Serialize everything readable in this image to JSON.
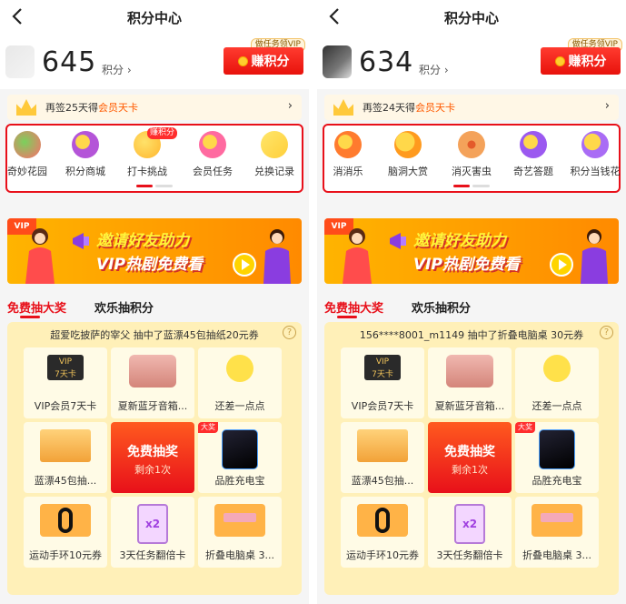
{
  "panels": [
    {
      "title": "积分中心",
      "points": "645",
      "points_unit": "积分 ›",
      "earn_label": "赚积分",
      "vip_tag": "做任务领VIP",
      "signin_prefix": "再签25天得",
      "signin_highlight": "会员天卡",
      "signin_arrow": "›",
      "icons": [
        {
          "label": "奇妙花园",
          "icon": "garden-icon",
          "color": "#ff6b6b"
        },
        {
          "label": "积分商城",
          "icon": "mall-icon",
          "color": "#b455d8"
        },
        {
          "label": "打卡挑战",
          "icon": "checkin-icon",
          "color": "#ffb52e",
          "badge": "赚积分"
        },
        {
          "label": "会员任务",
          "icon": "member-task-icon",
          "color": "#ff6aa0"
        },
        {
          "label": "兑换记录",
          "icon": "exchange-record-icon",
          "color": "#ffcf3a"
        }
      ],
      "banner_line1": "邀请好友助力",
      "banner_line2": "VIP热剧免费看",
      "banner_ribbon": "VIP",
      "tab_active": "免费抽大奖",
      "tab_inactive": "欢乐抽积分",
      "winner": "超爱吃披萨的宰父  抽中了蓝漂45包抽纸20元券",
      "help": "?",
      "prizes": [
        "VIP会员7天卡",
        "夏新蓝牙音箱...",
        "还差一点点",
        "蓝漂45包抽...",
        "品胜充电宝",
        "运动手环10元券",
        "3天任务翻倍卡",
        "折叠电脑桌 3..."
      ],
      "draw_title": "免费抽奖",
      "draw_sub": "剩余1次",
      "big_badge": "大奖",
      "vip_card_text": "VIP",
      "vip_card_sub": "7天卡",
      "double_card_text": "x2"
    },
    {
      "title": "积分中心",
      "points": "634",
      "points_unit": "积分 ›",
      "earn_label": "赚积分",
      "vip_tag": "做任务领VIP",
      "signin_prefix": "再签24天得",
      "signin_highlight": "会员天卡",
      "signin_arrow": "›",
      "icons": [
        {
          "label": "消消乐",
          "icon": "match-game-icon",
          "color": "#ff7b2e"
        },
        {
          "label": "脑洞大赏",
          "icon": "brain-icon",
          "color": "#ff9a1e"
        },
        {
          "label": "消灭害虫",
          "icon": "bug-icon",
          "color": "#f4a25a"
        },
        {
          "label": "奇艺答题",
          "icon": "quiz-icon",
          "color": "#9b59f0"
        },
        {
          "label": "积分当钱花",
          "icon": "points-money-icon",
          "color": "#a96cf5"
        }
      ],
      "banner_line1": "邀请好友助力",
      "banner_line2": "VIP热剧免费看",
      "banner_ribbon": "VIP",
      "tab_active": "免费抽大奖",
      "tab_inactive": "欢乐抽积分",
      "winner": "156****8001_m1149  抽中了折叠电脑桌 30元券",
      "help": "?",
      "prizes": [
        "VIP会员7天卡",
        "夏新蓝牙音箱...",
        "还差一点点",
        "蓝漂45包抽...",
        "品胜充电宝",
        "运动手环10元券",
        "3天任务翻倍卡",
        "折叠电脑桌 3..."
      ],
      "draw_title": "免费抽奖",
      "draw_sub": "剩余1次",
      "big_badge": "大奖",
      "vip_card_text": "VIP",
      "vip_card_sub": "7天卡",
      "double_card_text": "x2"
    }
  ],
  "colors": {
    "accent_red": "#e8101a",
    "highlight_orange": "#ff5a00",
    "lottery_bg": "#fff0b8"
  }
}
